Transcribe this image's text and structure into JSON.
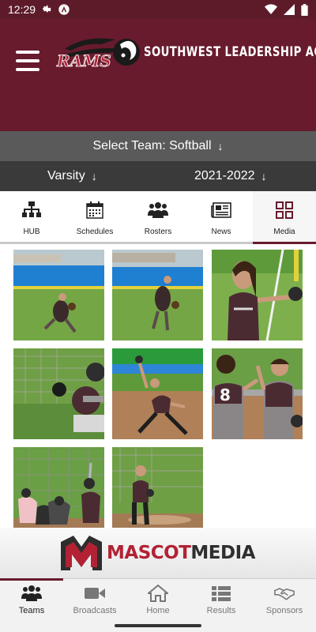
{
  "status_bar": {
    "time": "12:29",
    "icons": [
      "gear-icon",
      "accessibility-icon",
      "wifi-icon",
      "signal-icon",
      "battery-icon"
    ]
  },
  "header": {
    "logo_text": "RAMS",
    "school_name": "SOUTHWEST LEADERSHIP ACADEMY",
    "background_color": "#671b2c"
  },
  "team_selector": {
    "label": "Select Team: Softball",
    "arrow": "↓"
  },
  "filters": {
    "level": "Varsity",
    "season": "2021-2022",
    "arrow": "↓"
  },
  "tabs": [
    {
      "label": "HUB",
      "icon": "hierarchy-icon",
      "active": false
    },
    {
      "label": "Schedules",
      "icon": "calendar-icon",
      "active": false
    },
    {
      "label": "Rosters",
      "icon": "people-icon",
      "active": false
    },
    {
      "label": "News",
      "icon": "newspaper-icon",
      "active": false
    },
    {
      "label": "Media",
      "icon": "grid-icon",
      "active": true
    }
  ],
  "media": {
    "photos": [
      {
        "scene": "player fielding on grass near blue fence"
      },
      {
        "scene": "player running with glove near dugout"
      },
      {
        "scene": "player smiling in maroon jersey"
      },
      {
        "scene": "catcher crouched behind plate"
      },
      {
        "scene": "pitcher mid-windup on dirt"
      },
      {
        "scene": "two players high-fiving, jersey number 8"
      },
      {
        "scene": "batter at plate with catcher and umpire"
      },
      {
        "scene": "player standing in infield"
      }
    ],
    "jersey_number": "8"
  },
  "sponsor": {
    "logo_letter": "M",
    "name_part1": "MASCOT",
    "name_part2": "MEDIA"
  },
  "bottom_nav": [
    {
      "label": "Teams",
      "icon": "team-icon",
      "active": true
    },
    {
      "label": "Broadcasts",
      "icon": "video-camera-icon",
      "active": false
    },
    {
      "label": "Home",
      "icon": "home-icon",
      "active": false
    },
    {
      "label": "Results",
      "icon": "list-icon",
      "active": false
    },
    {
      "label": "Sponsors",
      "icon": "handshake-icon",
      "active": false
    }
  ],
  "colors": {
    "brand": "#671b2c",
    "status_bar": "#5d1b2a",
    "team_bar": "#5a5a5a",
    "filter_bar": "#3a3a3a",
    "sponsor_red": "#b22234"
  }
}
